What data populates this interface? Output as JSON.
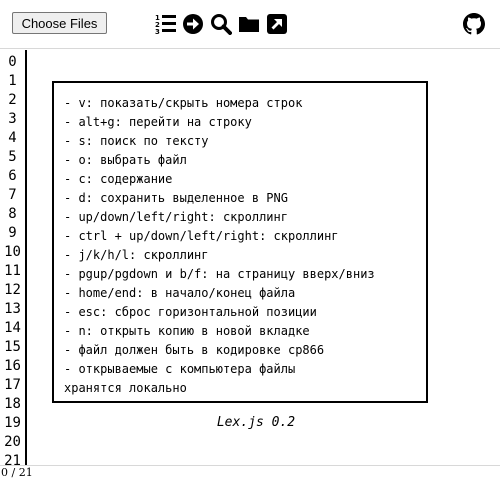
{
  "toolbar": {
    "choose_files_label": "Choose Files",
    "icons": [
      "line-numbers-icon",
      "go-to-line-icon",
      "search-icon",
      "open-folder-icon",
      "open-external-icon",
      "github-icon"
    ]
  },
  "gutter": {
    "line_numbers": [
      "0",
      "1",
      "2",
      "3",
      "4",
      "5",
      "6",
      "7",
      "8",
      "9",
      "10",
      "11",
      "12",
      "13",
      "14",
      "15",
      "16",
      "17",
      "18",
      "19",
      "20",
      "21"
    ]
  },
  "help": {
    "lines": [
      "- v: показать/скрыть номера строк",
      "- alt+g: перейти на строку",
      "- s: поиск по тексту",
      "- o: выбрать файл",
      "- c: содержание",
      "- d: сохранить выделенное в PNG",
      "- up/down/left/right: скроллинг",
      "- ctrl + up/down/left/right: скроллинг",
      "- j/k/h/l: скроллинг",
      "- pgup/pgdown и b/f: на страницу вверх/вниз",
      "- home/end: в начало/конец файла",
      "- esc: сброс горизонтальной позиции",
      "- n: открыть копию в новой вкладке",
      "- файл должен быть в кодировке cp866",
      "- открываемые с компьютера файлы",
      "хранятся локально"
    ]
  },
  "version": "Lex.js 0.2",
  "status": "0 / 21"
}
